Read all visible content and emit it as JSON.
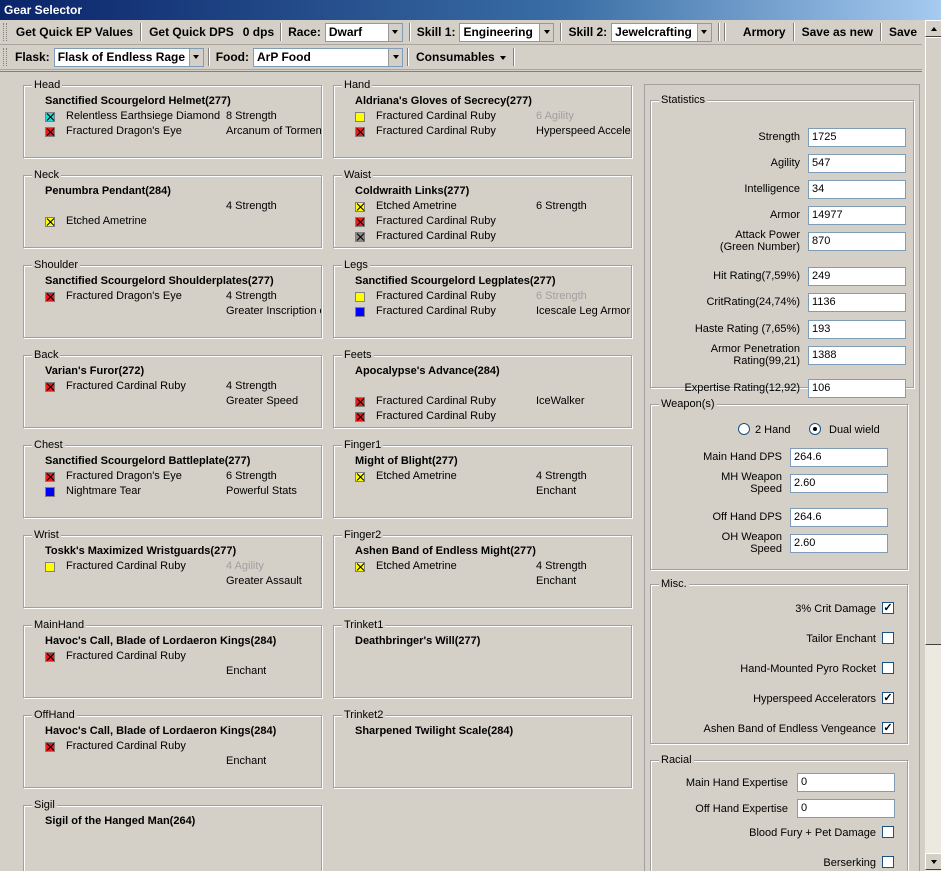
{
  "window": {
    "title": "Gear Selector"
  },
  "toolbar": {
    "quick_ep": "Get Quick EP Values",
    "quick_dps": "Get Quick DPS",
    "dps_value": "0 dps",
    "race_label": "Race:",
    "race_value": "Dwarf",
    "skill1_label": "Skill 1:",
    "skill1_value": "Engineering",
    "skill2_label": "Skill 2:",
    "skill2_value": "Jewelcrafting",
    "armory": "Armory",
    "save_as_new": "Save as new",
    "save": "Save",
    "flask_label": "Flask:",
    "flask_value": "Flask of Endless Rage",
    "food_label": "Food:",
    "food_value": "ArP Food",
    "consumables": "Consumables"
  },
  "colors": {
    "red": "#e81c1c",
    "yellow": "#ffff00",
    "blue": "#0000ff",
    "cyan": "#22d6d6",
    "gray": "#8a8a8a"
  },
  "slots": [
    {
      "slot": "Head",
      "item": "Sanctified Scourgelord Helmet(277)",
      "gems": [
        {
          "name": "Relentless Earthsiege Diamond",
          "color": "cyan",
          "x": true,
          "stat": "8 Strength",
          "dim": false
        },
        {
          "name": "Fractured Dragon's Eye",
          "color": "red",
          "x": true,
          "stat": "Arcanum of Torment",
          "dim": false
        }
      ]
    },
    {
      "slot": "Hand",
      "item": "Aldriana's Gloves of Secrecy(277)",
      "gems": [
        {
          "name": "Fractured Cardinal Ruby",
          "color": "yellow",
          "x": false,
          "stat": "6 Agility",
          "dim": true
        },
        {
          "name": "Fractured Cardinal Ruby",
          "color": "red",
          "x": true,
          "stat": "Hyperspeed Accelerators",
          "dim": false
        }
      ]
    },
    {
      "slot": "Neck",
      "item": "Penumbra Pendant(284)",
      "gems": [
        {
          "name": "",
          "color": "",
          "x": false,
          "stat": "4 Strength",
          "dim": false
        },
        {
          "name": "Etched Ametrine",
          "color": "yellow",
          "x": true,
          "stat": "",
          "dim": false
        }
      ]
    },
    {
      "slot": "Waist",
      "item": "Coldwraith Links(277)",
      "gems": [
        {
          "name": "Etched Ametrine",
          "color": "yellow",
          "x": true,
          "stat": "6 Strength",
          "dim": false
        },
        {
          "name": "Fractured Cardinal Ruby",
          "color": "red",
          "x": true,
          "stat": "",
          "dim": false
        },
        {
          "name": "Fractured Cardinal Ruby",
          "color": "gray",
          "x": true,
          "stat": "",
          "dim": false
        }
      ]
    },
    {
      "slot": "Shoulder",
      "item": "Sanctified Scourgelord Shoulderplates(277)",
      "gems": [
        {
          "name": "Fractured Dragon's Eye",
          "color": "red",
          "x": true,
          "stat": "4 Strength",
          "dim": false
        },
        {
          "name": "",
          "color": "",
          "x": false,
          "stat": "Greater Inscription of the Axe",
          "dim": false
        }
      ]
    },
    {
      "slot": "Legs",
      "item": "Sanctified Scourgelord Legplates(277)",
      "gems": [
        {
          "name": "Fractured Cardinal Ruby",
          "color": "yellow",
          "x": false,
          "stat": "6 Strength",
          "dim": true
        },
        {
          "name": "Fractured Cardinal Ruby",
          "color": "blue",
          "x": false,
          "stat": "Icescale Leg Armor",
          "dim": false
        }
      ]
    },
    {
      "slot": "Back",
      "item": "Varian's Furor(272)",
      "gems": [
        {
          "name": "Fractured Cardinal Ruby",
          "color": "red",
          "x": true,
          "stat": "4 Strength",
          "dim": false
        },
        {
          "name": "",
          "color": "",
          "x": false,
          "stat": "Greater Speed",
          "dim": false
        }
      ]
    },
    {
      "slot": "Feets",
      "item": "Apocalypse's Advance(284)",
      "gems": [
        {
          "name": "",
          "color": "",
          "x": false,
          "stat": "",
          "dim": false
        },
        {
          "name": "Fractured Cardinal Ruby",
          "color": "red",
          "x": true,
          "stat": "IceWalker",
          "dim": false
        },
        {
          "name": "Fractured Cardinal Ruby",
          "color": "red",
          "x": true,
          "stat": "",
          "dim": false
        }
      ]
    },
    {
      "slot": "Chest",
      "item": "Sanctified Scourgelord Battleplate(277)",
      "gems": [
        {
          "name": "Fractured Dragon's Eye",
          "color": "red",
          "x": true,
          "stat": "6 Strength",
          "dim": false
        },
        {
          "name": "Nightmare Tear",
          "color": "blue",
          "x": false,
          "stat": "Powerful Stats",
          "dim": false
        }
      ]
    },
    {
      "slot": "Finger1",
      "item": "Might of Blight(277)",
      "gems": [
        {
          "name": "Etched Ametrine",
          "color": "yellow",
          "x": true,
          "stat": "4 Strength",
          "dim": false
        },
        {
          "name": "",
          "color": "",
          "x": false,
          "stat": "Enchant",
          "dim": false
        }
      ]
    },
    {
      "slot": "Wrist",
      "item": "Toskk's Maximized Wristguards(277)",
      "gems": [
        {
          "name": "Fractured Cardinal Ruby",
          "color": "yellow",
          "x": false,
          "stat": "4 Agility",
          "dim": true
        },
        {
          "name": "",
          "color": "",
          "x": false,
          "stat": "Greater Assault",
          "dim": false
        }
      ]
    },
    {
      "slot": "Finger2",
      "item": "Ashen Band of Endless Might(277)",
      "gems": [
        {
          "name": "Etched Ametrine",
          "color": "yellow",
          "x": true,
          "stat": "4 Strength",
          "dim": false
        },
        {
          "name": "",
          "color": "",
          "x": false,
          "stat": "Enchant",
          "dim": false
        }
      ]
    },
    {
      "slot": "MainHand",
      "item": "Havoc's Call, Blade of Lordaeron Kings(284)",
      "gems": [
        {
          "name": "Fractured Cardinal Ruby",
          "color": "red",
          "x": true,
          "stat": "",
          "dim": false
        },
        {
          "name": "",
          "color": "",
          "x": false,
          "stat": "Enchant",
          "dim": false
        }
      ]
    },
    {
      "slot": "Trinket1",
      "item": "Deathbringer's Will(277)",
      "gems": []
    },
    {
      "slot": "OffHand",
      "item": "Havoc's Call, Blade of Lordaeron Kings(284)",
      "gems": [
        {
          "name": "Fractured Cardinal Ruby",
          "color": "red",
          "x": true,
          "stat": "",
          "dim": false
        },
        {
          "name": "",
          "color": "",
          "x": false,
          "stat": "Enchant",
          "dim": false
        }
      ]
    },
    {
      "slot": "Trinket2",
      "item": "Sharpened Twilight Scale(284)",
      "gems": []
    },
    {
      "slot": "Sigil",
      "item": "Sigil of the Hanged Man(264)",
      "gems": []
    }
  ],
  "statistics": {
    "legend": "Statistics",
    "rows": [
      {
        "label": "Strength",
        "value": "1725"
      },
      {
        "label": "Agility",
        "value": "547"
      },
      {
        "label": "Intelligence",
        "value": "34"
      },
      {
        "label": "Armor",
        "value": "14977"
      },
      {
        "label": "Attack Power\n(Green Number)",
        "value": "870"
      },
      {
        "label": "Hit Rating(7,59%)",
        "value": "249"
      },
      {
        "label": "CritRating(24,74%)",
        "value": "1136"
      },
      {
        "label": "Haste Rating (7,65%)",
        "value": "193"
      },
      {
        "label": "Armor Penetration\nRating(99,21)",
        "value": "1388"
      },
      {
        "label": "Expertise Rating(12,92)",
        "value": "106"
      }
    ]
  },
  "weapons": {
    "legend": "Weapon(s)",
    "two_hand": "2 Hand",
    "dual_wield": "Dual wield",
    "dual_wield_selected": true,
    "rows": [
      {
        "label": "Main Hand DPS",
        "value": "264.6"
      },
      {
        "label": "MH Weapon\nSpeed",
        "value": "2.60"
      },
      {
        "label": "Off Hand DPS",
        "value": "264.6"
      },
      {
        "label": "OH Weapon\nSpeed",
        "value": "2.60"
      }
    ]
  },
  "misc": {
    "legend": "Misc.",
    "rows": [
      {
        "label": "3% Crit Damage",
        "checked": true
      },
      {
        "label": "Tailor Enchant",
        "checked": false
      },
      {
        "label": "Hand-Mounted Pyro Rocket",
        "checked": false
      },
      {
        "label": "Hyperspeed Accelerators",
        "checked": true
      },
      {
        "label": "Ashen Band of Endless Vengeance",
        "checked": true
      }
    ]
  },
  "racial": {
    "legend": "Racial",
    "main_hand_expertise_label": "Main Hand Expertise",
    "main_hand_expertise_value": "0",
    "off_hand_expertise_label": "Off Hand Expertise",
    "off_hand_expertise_value": "0",
    "checks": [
      {
        "label": "Blood Fury + Pet Damage",
        "checked": false
      },
      {
        "label": "Berserking",
        "checked": false
      }
    ]
  }
}
